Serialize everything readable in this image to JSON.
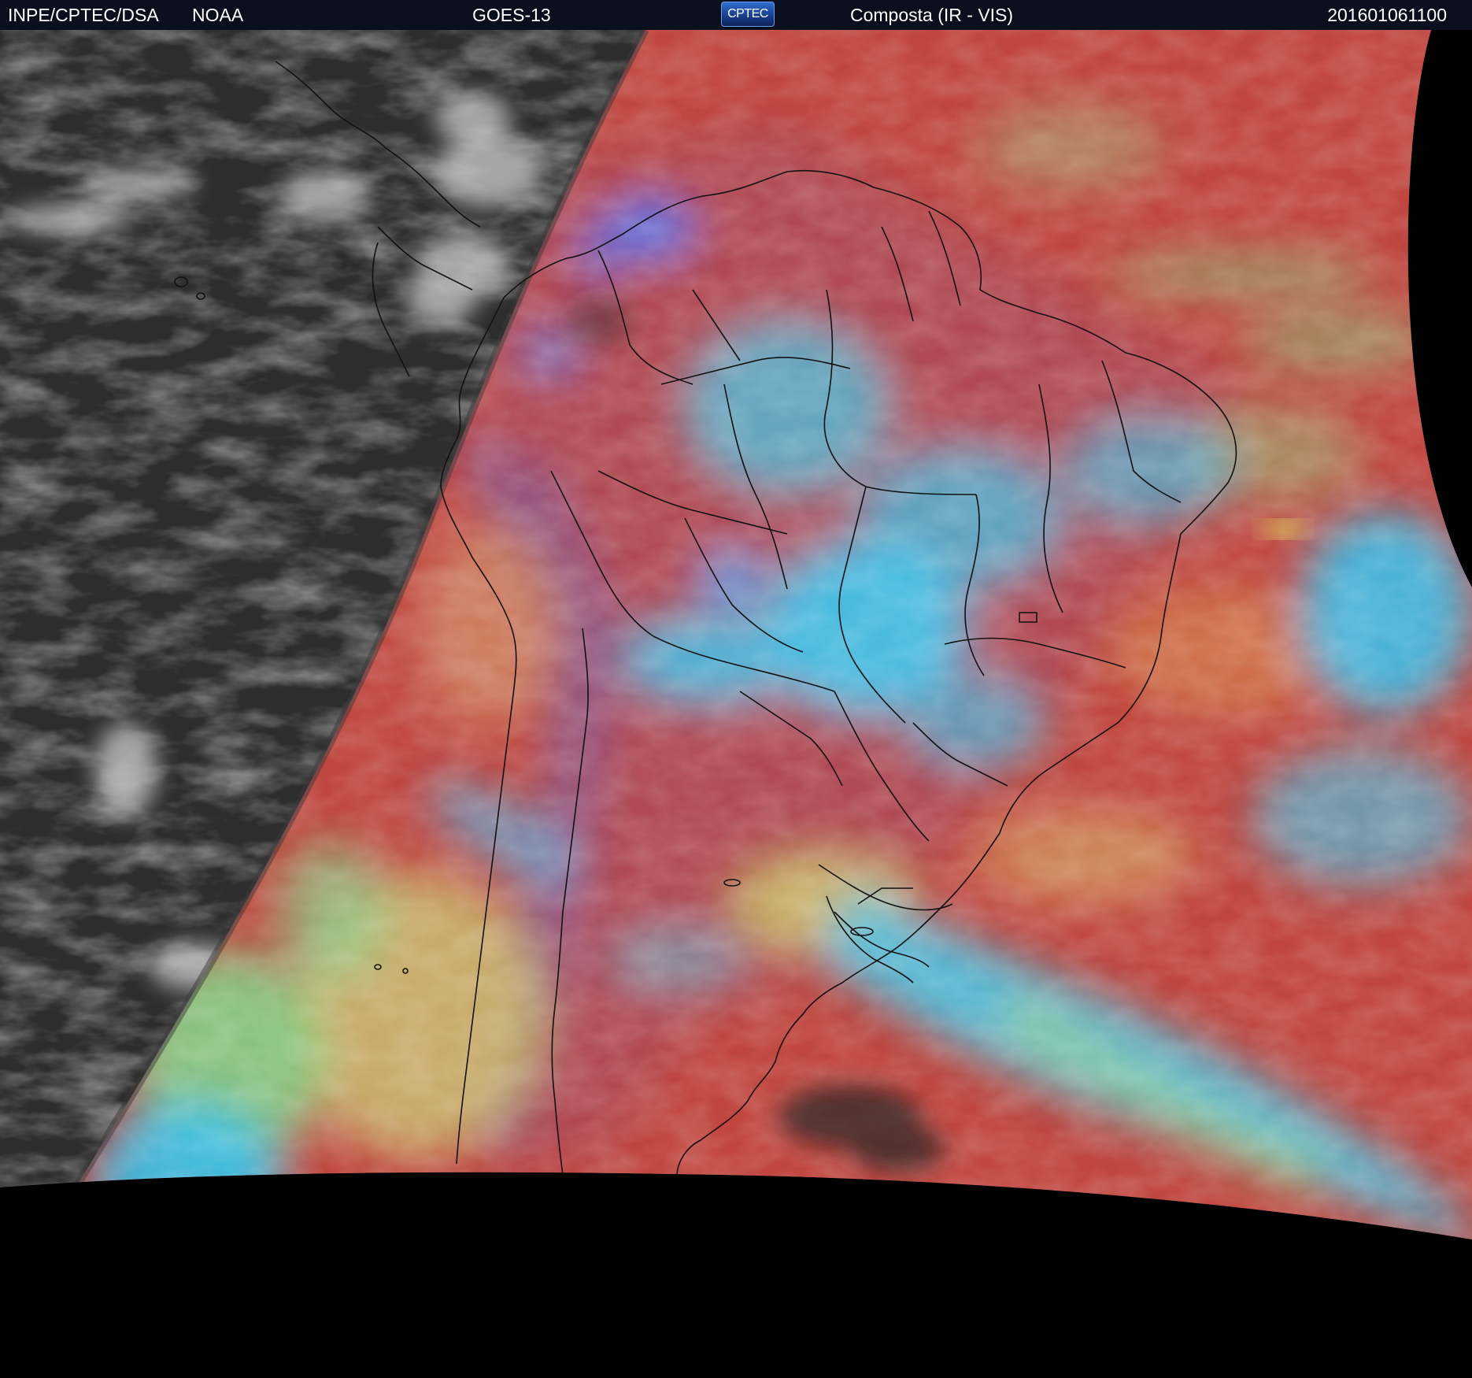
{
  "header": {
    "organization": "INPE/CPTEC/DSA",
    "agency": "NOAA",
    "satellite": "GOES-13",
    "logo_text": "CPTEC",
    "product": "Composta (IR - VIS)",
    "timestamp": "201601061100"
  },
  "colors": {
    "header_background": "#0a0f1e",
    "night_side": "#2f2f2f",
    "land_red": "#b5474a",
    "ocean_red": "#c24a44",
    "cold_cloud_cyan": "#3fc6e6",
    "bright_cloud_blue": "#3e7ff0",
    "low_cloud_yellow_green": "#c8c46a",
    "green_clouds": "#7fe08a",
    "outside_disk": "#000000",
    "coastline": "#111111"
  }
}
